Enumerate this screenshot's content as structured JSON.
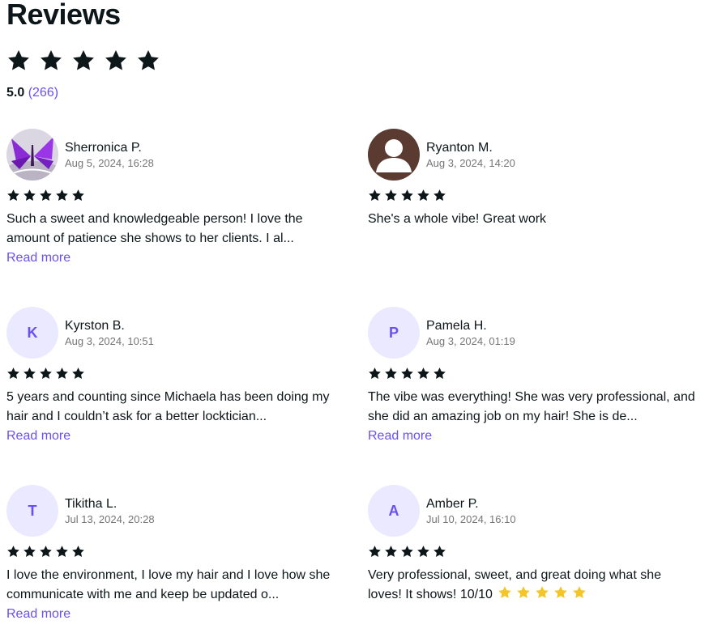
{
  "page": {
    "title": "Reviews",
    "rating": "5.0",
    "rating_count": "(266)"
  },
  "colors": {
    "accent": "#6950f3",
    "star": "#0d1619",
    "emoji_star": "#f5c528",
    "avatar_bg": "#ebe9ff"
  },
  "reviews": [
    {
      "name": "Sherronica P.",
      "date": "Aug 5, 2024, 16:28",
      "avatar": "photo-butterfly",
      "stars": 5,
      "text": "Such a sweet and knowledgeable person!  I love the amount of patience she shows to her clients. I al...",
      "read_more": "Read more"
    },
    {
      "name": "Ryanton M.",
      "date": "Aug 3, 2024, 14:20",
      "avatar": "default-user-icon",
      "stars": 5,
      "text": "She's a whole vibe! Great work",
      "read_more": ""
    },
    {
      "name": "Kyrston B.",
      "date": "Aug 3, 2024, 10:51",
      "initial": "K",
      "stars": 5,
      "text": "5 years and counting since Michaela has been doing my hair and I couldn’t ask for a better locktician...",
      "read_more": "Read more"
    },
    {
      "name": "Pamela H.",
      "date": "Aug 3, 2024, 01:19",
      "initial": "P",
      "stars": 5,
      "text": "The vibe was everything! She was very professional, and she did an amazing job on my hair! She is de...",
      "read_more": "Read more"
    },
    {
      "name": "Tikitha L.",
      "date": "Jul 13, 2024, 20:28",
      "initial": "T",
      "stars": 5,
      "text": "I love the environment,  I love my hair and I love how she communicate with me and keep be updated o...",
      "read_more": "Read more"
    },
    {
      "name": "Amber P.",
      "date": "Jul 10, 2024, 16:10",
      "initial": "A",
      "stars": 5,
      "text": "Very professional, sweet, and great doing what she loves! It shows! 10/10",
      "emoji_stars": 5,
      "read_more": ""
    }
  ]
}
